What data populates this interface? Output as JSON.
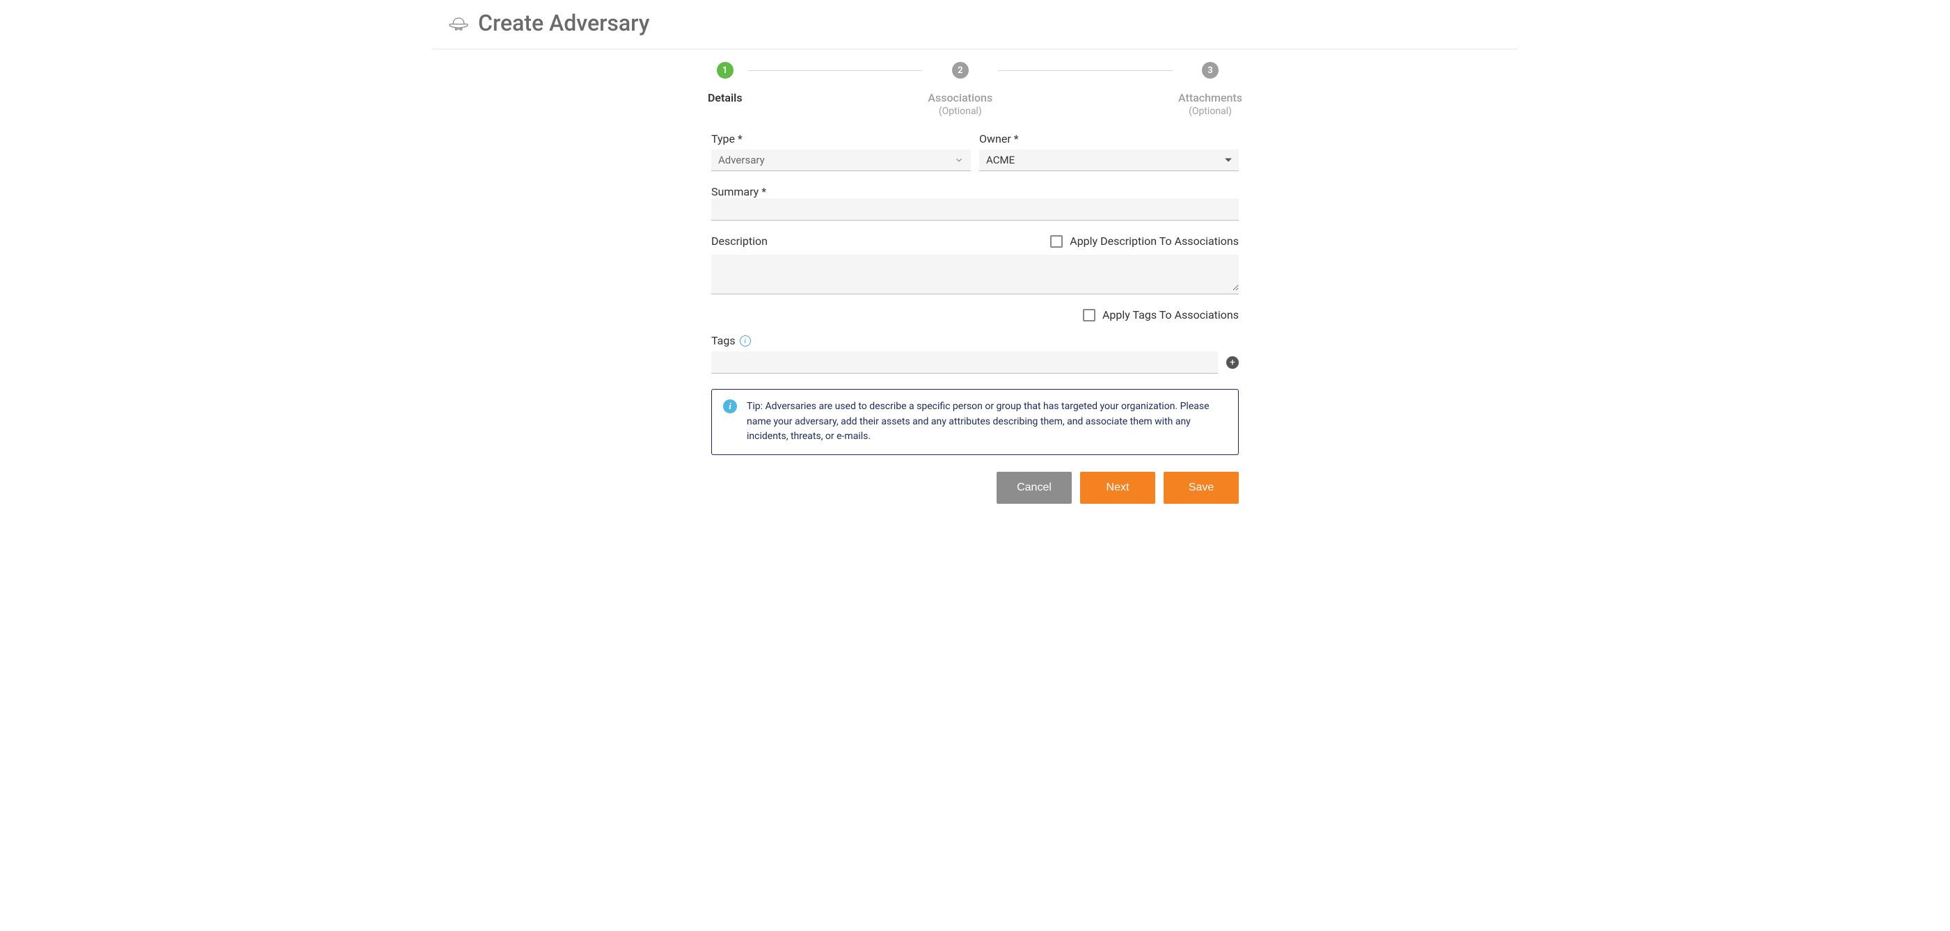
{
  "header": {
    "title": "Create Adversary"
  },
  "stepper": {
    "step1": {
      "num": "1",
      "label": "Details"
    },
    "step2": {
      "num": "2",
      "label": "Associations",
      "sub": "(Optional)"
    },
    "step3": {
      "num": "3",
      "label": "Attachments",
      "sub": "(Optional)"
    }
  },
  "form": {
    "type_label": "Type *",
    "type_value": "Adversary",
    "owner_label": "Owner *",
    "owner_value": "ACME",
    "summary_label": "Summary *",
    "summary_value": "",
    "description_label": "Description",
    "description_value": "",
    "apply_desc_label": "Apply Description To Associations",
    "apply_tags_label": "Apply Tags To Associations",
    "tags_label": "Tags",
    "tags_value": ""
  },
  "tip": {
    "text": "Tip: Adversaries are used to describe a specific person or group that has targeted your organization. Please name your adversary, add their assets and any attributes describing them, and associate them with any incidents, threats, or e-mails."
  },
  "buttons": {
    "cancel": "Cancel",
    "next": "Next",
    "save": "Save"
  }
}
